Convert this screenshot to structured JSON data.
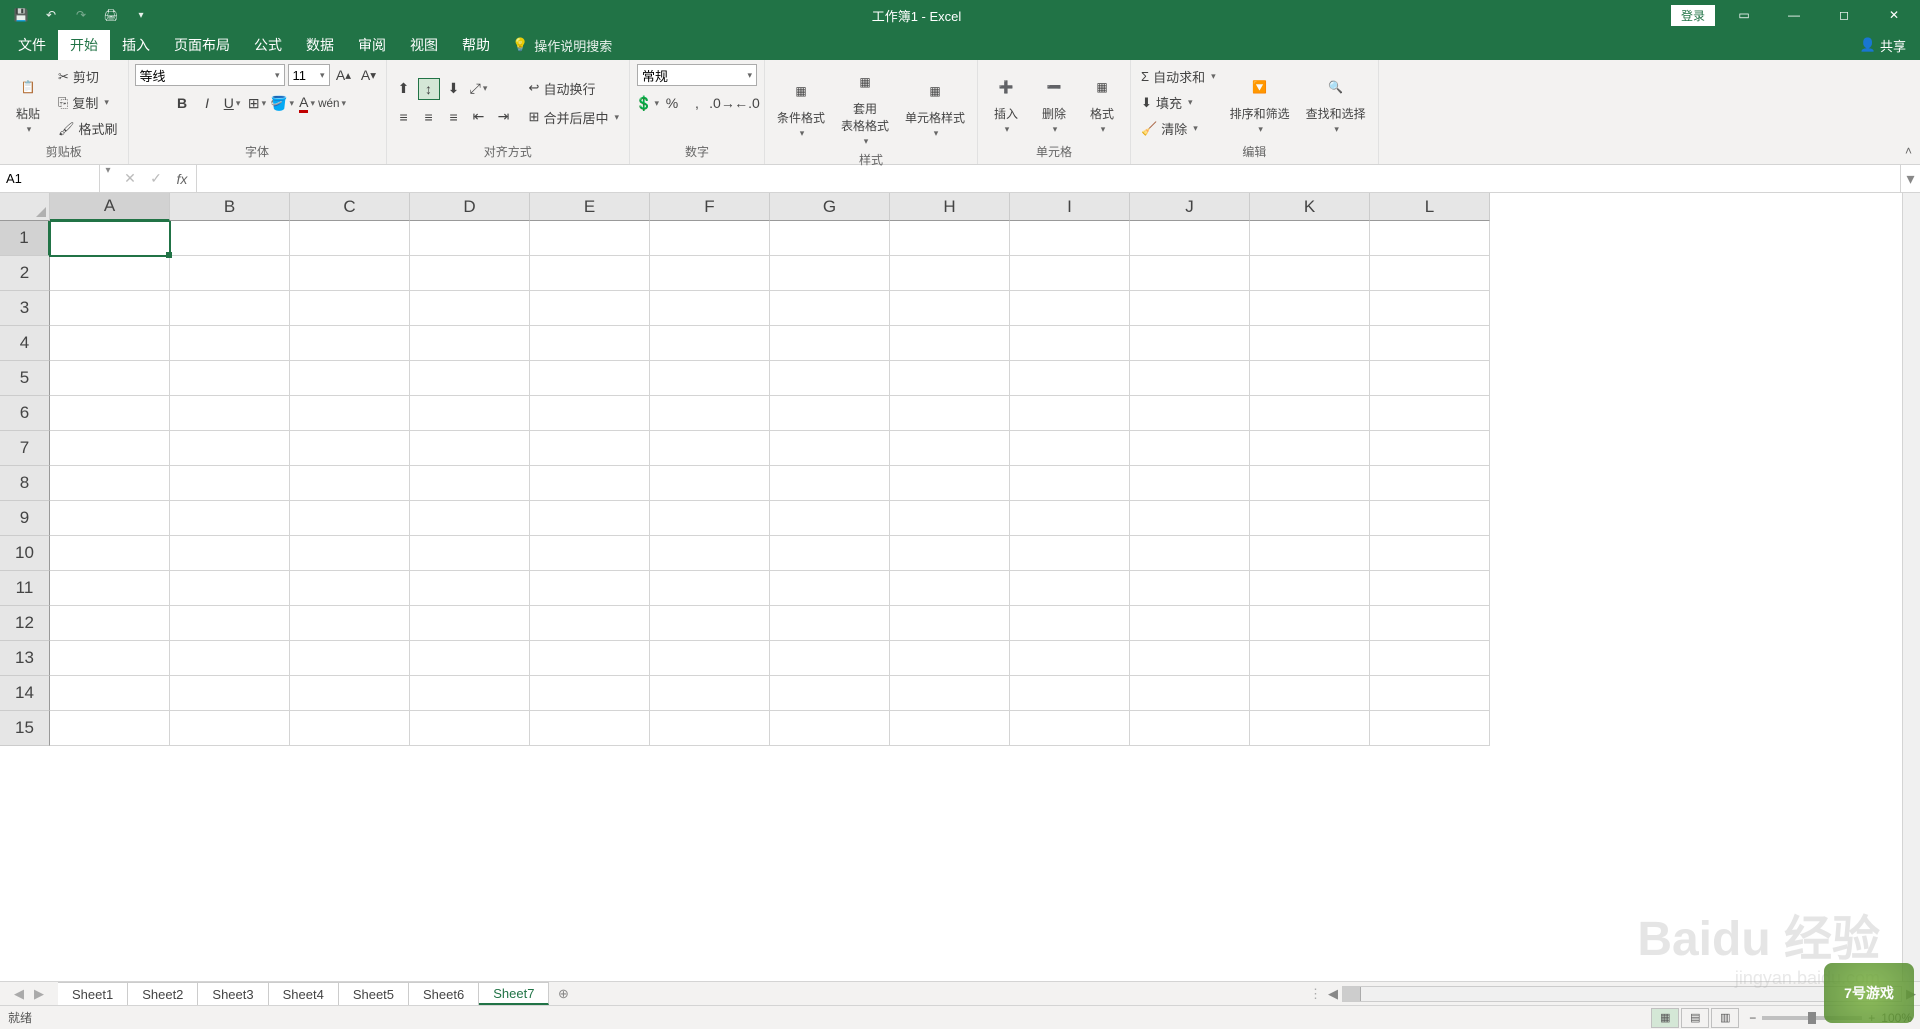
{
  "title": "工作簿1 - Excel",
  "login": "登录",
  "tabs": [
    "文件",
    "开始",
    "插入",
    "页面布局",
    "公式",
    "数据",
    "审阅",
    "视图",
    "帮助"
  ],
  "active_tab": "开始",
  "tellme": "操作说明搜索",
  "share": "共享",
  "clipboard": {
    "paste": "粘贴",
    "cut": "剪切",
    "copy": "复制",
    "format_painter": "格式刷",
    "label": "剪贴板"
  },
  "font": {
    "name": "等线",
    "size": "11",
    "label": "字体"
  },
  "alignment": {
    "wrap": "自动换行",
    "merge": "合并后居中",
    "label": "对齐方式"
  },
  "number": {
    "format": "常规",
    "label": "数字"
  },
  "styles": {
    "conditional": "条件格式",
    "table": "套用\n表格格式",
    "cell": "单元格样式",
    "label": "样式"
  },
  "cells": {
    "insert": "插入",
    "delete": "删除",
    "format": "格式",
    "label": "单元格"
  },
  "editing": {
    "autosum": "自动求和",
    "fill": "填充",
    "clear": "清除",
    "sort": "排序和筛选",
    "find": "查找和选择",
    "label": "编辑"
  },
  "namebox": "A1",
  "columns": [
    "A",
    "B",
    "C",
    "D",
    "E",
    "F",
    "G",
    "H",
    "I",
    "J",
    "K",
    "L"
  ],
  "rows": [
    "1",
    "2",
    "3",
    "4",
    "5",
    "6",
    "7",
    "8",
    "9",
    "10",
    "11",
    "12",
    "13",
    "14",
    "15"
  ],
  "sheets": [
    "Sheet1",
    "Sheet2",
    "Sheet3",
    "Sheet4",
    "Sheet5",
    "Sheet6",
    "Sheet7"
  ],
  "active_sheet": "Sheet7",
  "status": "就绪",
  "zoom": "100%",
  "watermark": "Baidu 经验",
  "watermark_sub": "jingyan.baidu.com",
  "badge": "7号游戏"
}
